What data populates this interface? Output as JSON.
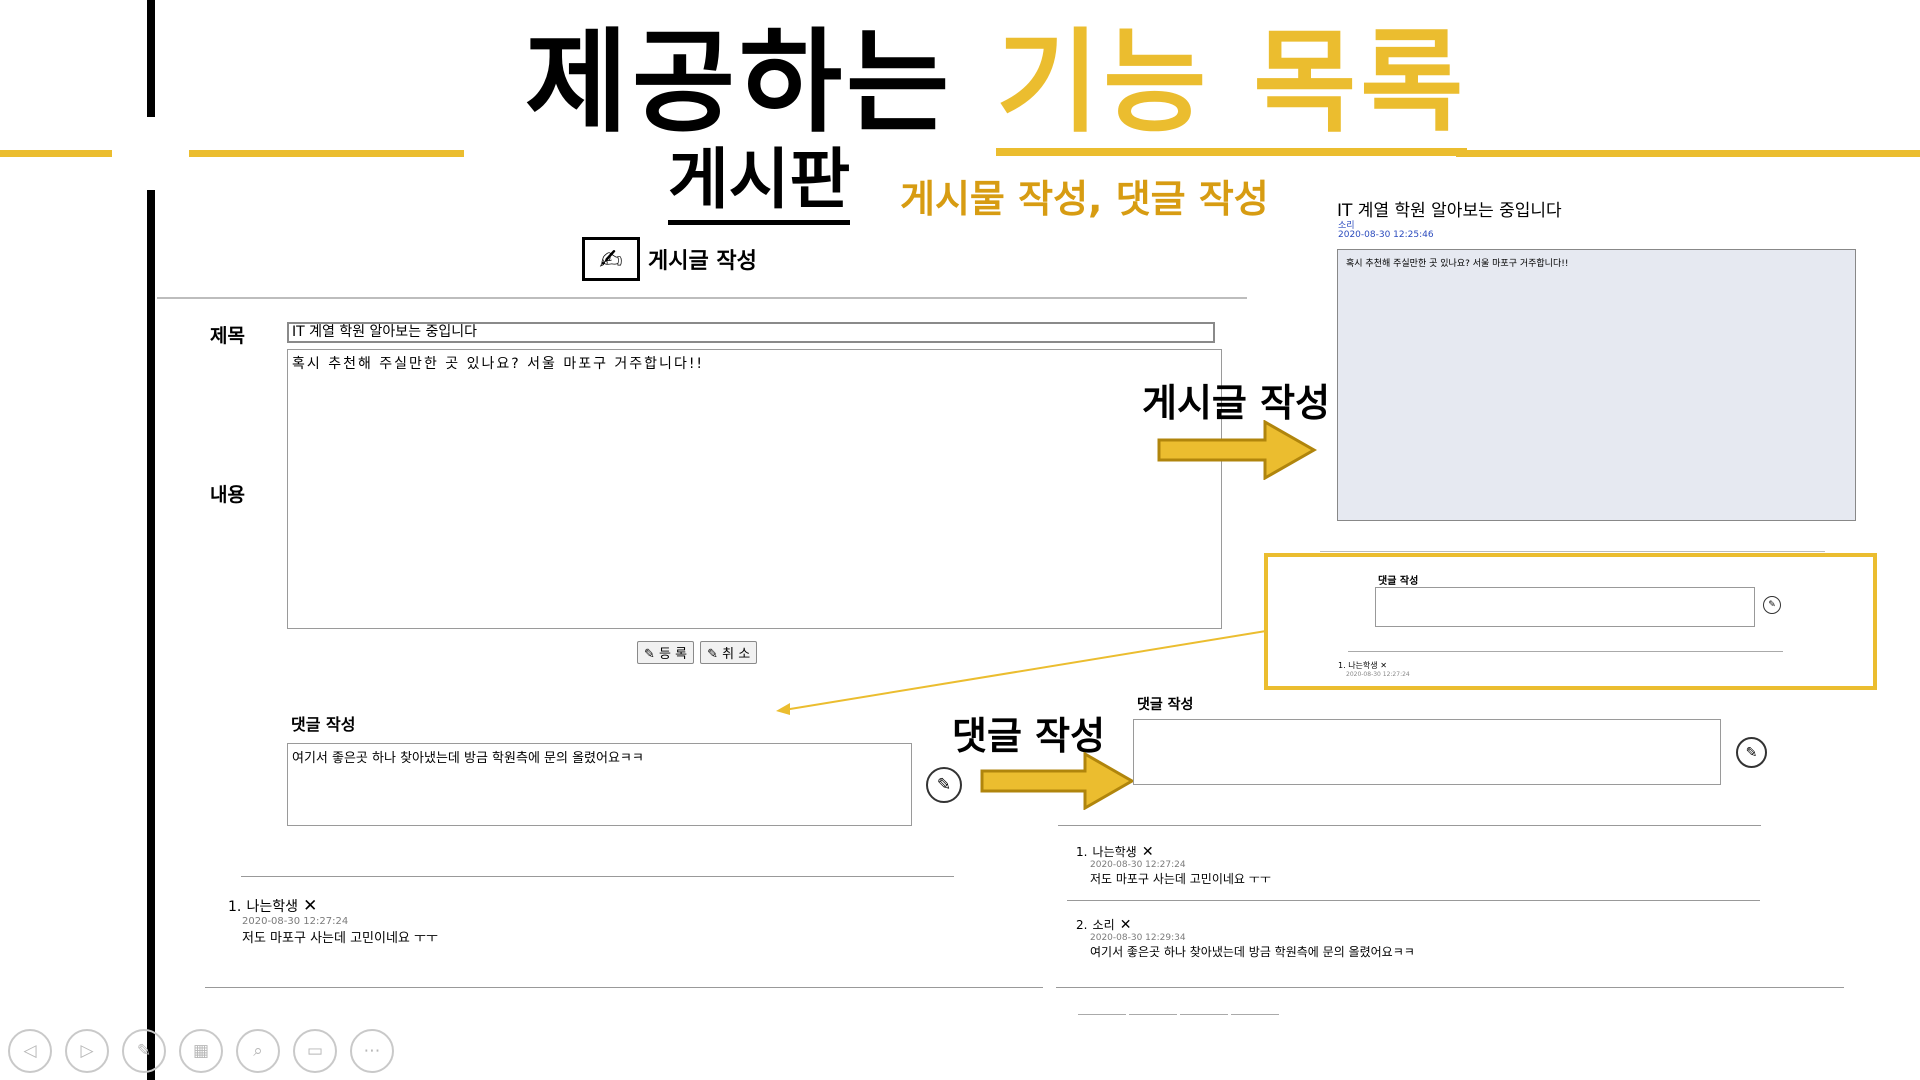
{
  "slide": {
    "title_black": "제공하는",
    "title_yellow": "기능 목록",
    "section": "게시판",
    "section_desc": "게시물 작성, 댓글 작성"
  },
  "write_form": {
    "header": "게시글 작성",
    "title_label": "제목",
    "title_value": "IT 계열 학원 알아보는 중입니다",
    "content_label": "내용",
    "content_value": "혹시 추천해 주실만한 곳 있나요? 서울 마포구 거주합니다!!",
    "register_button": "등 록",
    "cancel_button": "취 소"
  },
  "comment_form_left": {
    "label": "댓글 작성",
    "value": "여기서 좋은곳 하나 찾아냈는데 방금 학원측에 문의 올렸어요ㅋㅋ",
    "comments": [
      {
        "index": "1.",
        "author": "나는학생",
        "date": "2020-08-30 12:27:24",
        "text": "저도 마포구 사는데 고민이네요 ㅜㅜ"
      }
    ]
  },
  "arrows": {
    "post_label": "게시글 작성",
    "comment_label": "댓글 작성"
  },
  "post_view": {
    "title": "IT 계열 학원 알아보는 중입니다",
    "author": "소리",
    "date": "2020-08-30 12:25:46",
    "content": "혹시 추천해 주실만한 곳 있나요? 서울 마포구 거주합니다!!"
  },
  "comment_zoom": {
    "label": "댓글 작성",
    "first_index": "1.",
    "first_author": "나는학생",
    "first_date": "2020-08-30 12:27:24"
  },
  "comment_form_right": {
    "label": "댓글 작성",
    "comments": [
      {
        "index": "1.",
        "author": "나는학생",
        "date": "2020-08-30 12:27:24",
        "text": "저도 마포구 사는데 고민이네요 ㅜㅜ"
      },
      {
        "index": "2.",
        "author": "소리",
        "date": "2020-08-30 12:29:34",
        "text": "여기서 좋은곳 하나 찾아냈는데 방금 학원측에 문의 올렸어요ㅋㅋ"
      }
    ]
  },
  "icons": {
    "x": "✕",
    "pen": "✎",
    "write": "✍",
    "ctrl_prev": "◁",
    "ctrl_next": "▷",
    "ctrl_pen": "✎",
    "ctrl_slides": "▦",
    "ctrl_zoom": "⌕",
    "ctrl_sub": "▭",
    "ctrl_more": "⋯"
  },
  "colors": {
    "accent": "#ebbd2f",
    "accent_dark": "#d79c12",
    "arrow_border": "#b0850c"
  }
}
